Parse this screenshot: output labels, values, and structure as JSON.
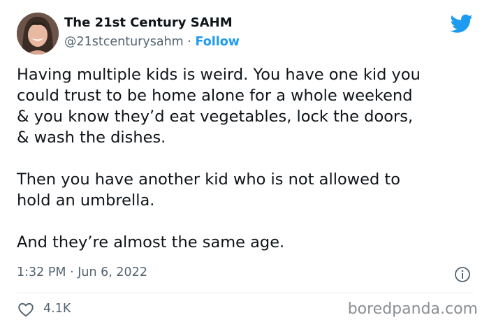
{
  "author": {
    "name": "The 21st Century SAHM",
    "handle": "@21stcenturysahm",
    "separator": "·",
    "follow_label": "Follow"
  },
  "tweet": {
    "paragraphs": [
      "Having multiple kids is weird. You have one kid you\ncould trust to be home alone for a whole weekend\n& you know they’d eat vegetables, lock the doors,\n& wash the dishes.",
      "Then you have another kid who is not allowed to\nhold an umbrella.",
      "And they’re almost the same age."
    ],
    "time": "1:32 PM",
    "separator": "·",
    "date": "Jun 6, 2022"
  },
  "engagement": {
    "likes": "4.1K"
  },
  "watermark": "boredpanda.com",
  "icons": {
    "brand": "twitter-bird-icon",
    "info": "info-icon",
    "like": "heart-icon"
  },
  "colors": {
    "accent": "#1d9bf0",
    "text": "#0f1419",
    "secondary": "#536471",
    "divider": "#e6ecf0",
    "watermark": "#8a8f94"
  }
}
